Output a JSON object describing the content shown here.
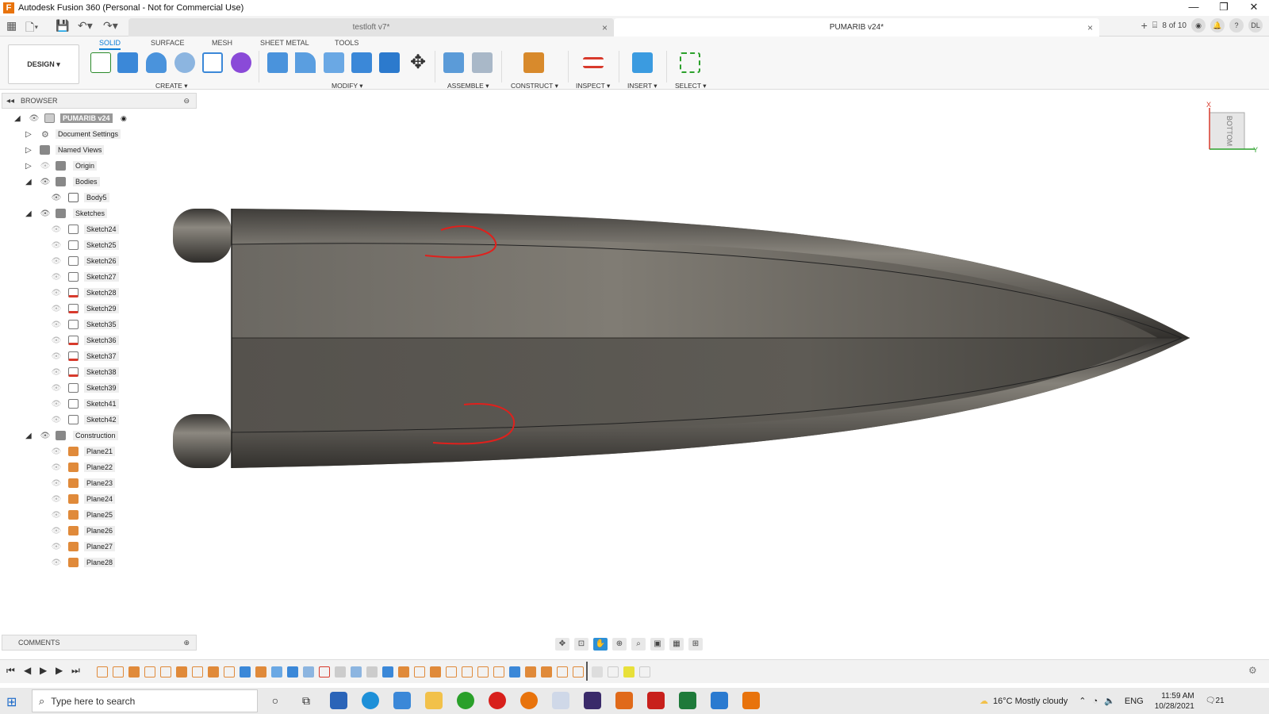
{
  "window": {
    "title": "Autodesk Fusion 360 (Personal - Not for Commercial Use)",
    "minimize": "—",
    "restore": "❐",
    "close": "✕"
  },
  "tabs": {
    "inactive_doc": "testloft v7*",
    "active_doc": "PUMARIB v24*",
    "close": "×",
    "doc_count": "8 of 10",
    "user": "DL"
  },
  "ribbon": {
    "tabs": [
      "SOLID",
      "SURFACE",
      "MESH",
      "SHEET METAL",
      "TOOLS"
    ],
    "workspace": "DESIGN",
    "groups": {
      "create": "CREATE",
      "modify": "MODIFY",
      "assemble": "ASSEMBLE",
      "construct": "CONSTRUCT",
      "inspect": "INSPECT",
      "insert": "INSERT",
      "select": "SELECT"
    }
  },
  "browser": {
    "header": "BROWSER",
    "root": "PUMARIB v24",
    "items": [
      "Document Settings",
      "Named Views",
      "Origin",
      "Bodies",
      "Body5",
      "Sketches",
      "Sketch24",
      "Sketch25",
      "Sketch26",
      "Sketch27",
      "Sketch28",
      "Sketch29",
      "Sketch35",
      "Sketch36",
      "Sketch37",
      "Sketch38",
      "Sketch39",
      "Sketch41",
      "Sketch42",
      "Construction",
      "Plane21",
      "Plane22",
      "Plane23",
      "Plane24",
      "Plane25",
      "Plane26",
      "Plane27",
      "Plane28"
    ]
  },
  "viewcube": {
    "face": "BOTTOM",
    "x_axis": "X",
    "y_axis": "Y"
  },
  "comments": {
    "label": "COMMENTS"
  },
  "taskbar": {
    "search_placeholder": "Type here to search",
    "weather": "16°C  Mostly cloudy",
    "lang": "ENG",
    "time": "11:59 AM",
    "date": "10/28/2021",
    "notif": "21"
  },
  "colors": {
    "accent": "#0a7dd6",
    "annotation": "#e0201c",
    "hull": "#5d5a55"
  }
}
